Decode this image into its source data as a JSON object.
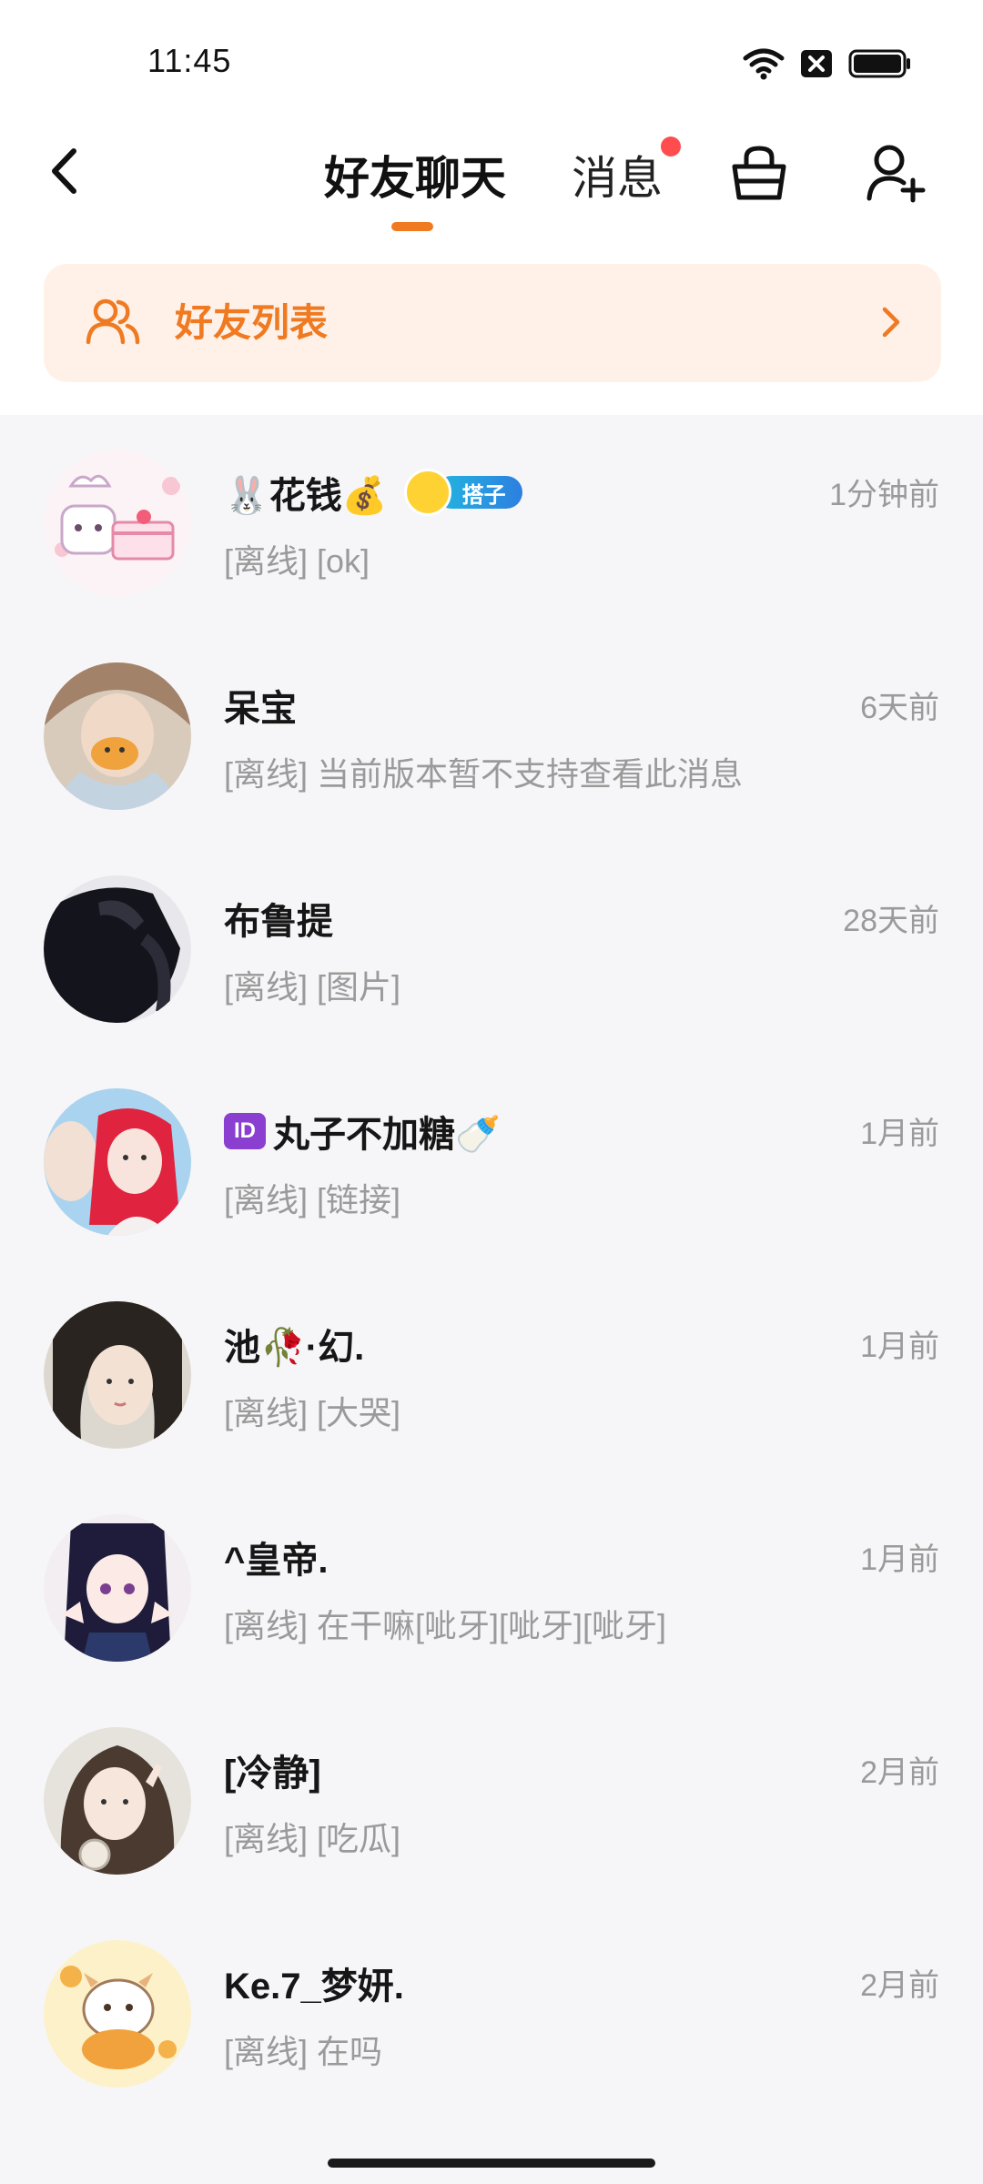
{
  "status_bar": {
    "time": "11:45",
    "icons": [
      "wifi-icon",
      "sim-blocked-icon",
      "battery-icon"
    ]
  },
  "header": {
    "back_icon": "back-arrow-icon",
    "tabs": [
      {
        "label": "好友聊天",
        "active": true
      },
      {
        "label": "消息",
        "active": false,
        "has_dot": true
      }
    ],
    "action_icons": [
      "basket-icon",
      "add-user-icon"
    ],
    "accent_color": "#f07a1f"
  },
  "friends_banner": {
    "label": "好友列表",
    "icon": "users-icon",
    "chevron": "chevron-right-icon",
    "background": "#fff1e8"
  },
  "chats": [
    {
      "name": "🐰花钱💰",
      "badge": "搭子",
      "time": "1分钟前",
      "preview": "[离线] [ok]"
    },
    {
      "name": "呆宝",
      "time": "6天前",
      "preview": "[离线] 当前版本暂不支持查看此消息"
    },
    {
      "name": "布鲁提",
      "time": "28天前",
      "preview": "[离线] [图片]"
    },
    {
      "name": "丸子不加糖🍼",
      "id_badge": "ID",
      "time": "1月前",
      "preview": "[离线] [链接]"
    },
    {
      "name": "池🥀·幻.",
      "time": "1月前",
      "preview": "[离线] [大哭]"
    },
    {
      "name": "^皇帝.",
      "time": "1月前",
      "preview": "[离线] 在干嘛[呲牙][呲牙][呲牙]"
    },
    {
      "name": "[冷静]",
      "time": "2月前",
      "preview": "[离线] [吃瓜]"
    },
    {
      "name": "Ke.7_梦妍.",
      "time": "2月前",
      "preview": "[离线] 在吗"
    }
  ]
}
